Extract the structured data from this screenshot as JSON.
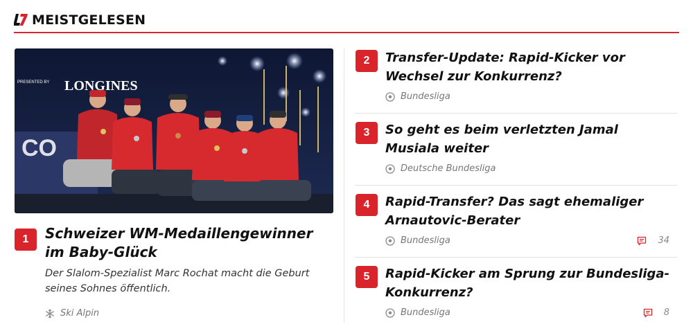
{
  "header": {
    "logo_text": "L7",
    "title": "MEISTGELESEN"
  },
  "colors": {
    "accent": "#d8242a",
    "text": "#111111",
    "muted": "#777777"
  },
  "hero": {
    "rank": "1",
    "title": "Schweizer WM-Medaillengewinner im Baby-Glück",
    "teaser": "Der Slalom-Spezialist Marc Rochat macht die Geburt seines Sohnes öffentlich.",
    "category": "Ski Alpin",
    "category_icon": "snowflake-icon",
    "image": {
      "sponsor_label": "PRESENTED BY",
      "sponsor_name": "LONGINES"
    }
  },
  "articles": [
    {
      "rank": "2",
      "title": "Transfer-Update: Rapid-Kicker vor Wechsel zur Konkurrenz?",
      "category": "Bundesliga",
      "category_icon": "soccer-ball-icon",
      "comments": ""
    },
    {
      "rank": "3",
      "title": "So geht es beim verletzten Jamal Musiala weiter",
      "category": "Deutsche Bundesliga",
      "category_icon": "soccer-ball-icon",
      "comments": ""
    },
    {
      "rank": "4",
      "title": "Rapid-Transfer? Das sagt ehemaliger Arnautovic-Berater",
      "category": "Bundesliga",
      "category_icon": "soccer-ball-icon",
      "comments": "34"
    },
    {
      "rank": "5",
      "title": "Rapid-Kicker am Sprung zur Bundesliga-Konkurrenz?",
      "category": "Bundesliga",
      "category_icon": "soccer-ball-icon",
      "comments": "8"
    }
  ]
}
